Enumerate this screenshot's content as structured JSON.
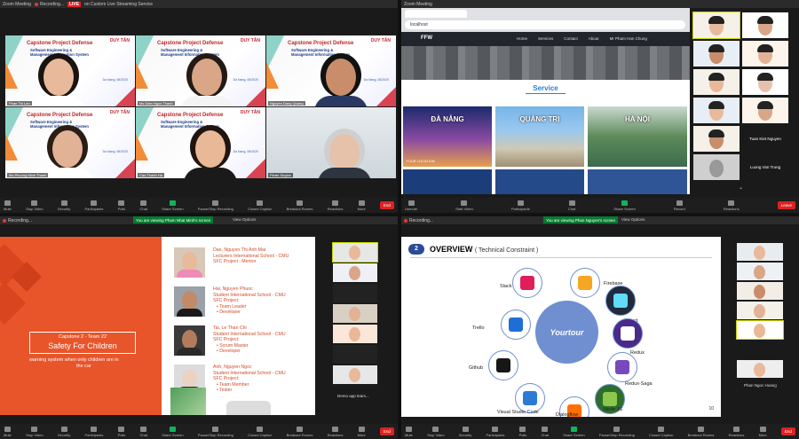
{
  "w1": {
    "title": "Zoom Meeting",
    "rec": "Recording...",
    "live": "LIVE",
    "stream": "on Custom Live Streaming Service",
    "tiles": [
      {
        "name": "Phan Thi Lan"
      },
      {
        "name": "Ms Dam Ngoc Thanh"
      },
      {
        "name": "Nguyen Dang Quang"
      },
      {
        "name": "Ms Phuong Minh Thanh"
      },
      {
        "name": "Cao Thanh Ha"
      },
      {
        "name": "Pieter Sluyter"
      }
    ],
    "slide_title": "Capstone Project Defense",
    "slide_sub1": "Software Engineering &",
    "slide_sub2": "Management Information System",
    "logo": "DUY TÂN",
    "date": "Da Nang, 06/2020",
    "toolbar": [
      "Mute",
      "Stop Video",
      "Security",
      "Participants",
      "Polls",
      "Chat",
      "Share Screen",
      "Pause/Stop Recording",
      "Closed Caption",
      "Breakout Rooms",
      "Reactions",
      "More"
    ],
    "end": "End"
  },
  "w2": {
    "url": "localhost",
    "brand": "FFW",
    "nav": [
      "Home",
      "Services",
      "Contact",
      "About",
      "Mr Pham Han Chung"
    ],
    "section": "Service",
    "cities": [
      "ĐÀ NẴNG",
      "QUẢNG TRỊ",
      "HÀ NỘI"
    ],
    "location": "YOUR LOCATION",
    "participants": [
      "Tuan Kiet Nguyen",
      "Luong Van Trung"
    ],
    "toolbar": [
      "Unmute",
      "Start Video",
      "Participants",
      "Chat",
      "Share Screen",
      "Record",
      "Reactions"
    ],
    "end": "Leave"
  },
  "w3": {
    "rec": "Recording...",
    "banner": "You are viewing Pham Nhat Minh's screen",
    "options": "View Options",
    "team": "Capstone 2 - Team 22",
    "project": "Safety For Children",
    "desc1": "warning system when only children are in",
    "desc2": "the car",
    "members": [
      {
        "l1": "Dao, Nguyen Thi Anh Mai",
        "l2": "Lecturers International School - CMU",
        "l3": "SFC Project : Mentor",
        "b": []
      },
      {
        "l1": "Hai, Nguyen Phuoc",
        "l2": "Student International School - CMU",
        "l3": "SFC Project:",
        "b": [
          "Team Leader",
          "Developer"
        ]
      },
      {
        "l1": "Tai, Le Than Chi",
        "l2": "Student International School - CMU",
        "l3": "SFC Project:",
        "b": [
          "Scrum Master",
          "Developer"
        ]
      },
      {
        "l1": "Anh, Nguyen Ngoc",
        "l2": "Student International School - CMU",
        "l3": "SFC Project:",
        "b": [
          "Team Member",
          "Tester"
        ]
      }
    ],
    "side": "Demo app team...",
    "toolbar": [
      "Mute",
      "Stop Video",
      "Security",
      "Participants",
      "Polls",
      "Chat",
      "Share Screen",
      "Pause/Stop Recording",
      "Closed Caption",
      "Breakout Rooms",
      "Reactions",
      "More"
    ],
    "end": "End"
  },
  "w4": {
    "rec": "Recording...",
    "banner": "You are viewing Phan Nguyen's screen",
    "options": "View Options",
    "num": "2",
    "heading": "OVERVIEW",
    "heading2": "( Technical Constraint )",
    "center": "Yourtour",
    "techs": [
      "Slack",
      "Firebase",
      "React",
      "Redux",
      "Redux-Saga",
      "Node JS",
      "Dialogflow",
      "Visual Studio Code",
      "Github",
      "Trello"
    ],
    "page": "10",
    "side": "Phan Ngoc Hoang",
    "toolbar": [
      "Mute",
      "Stop Video",
      "Security",
      "Participants",
      "Polls",
      "Chat",
      "Share Screen",
      "Pause/Stop Recording",
      "Closed Caption",
      "Breakout Rooms",
      "Reactions",
      "More"
    ],
    "end": "End"
  },
  "colors": {
    "accent": "#0a7a31",
    "end": "#dd2222",
    "slide_orange": "#e8552b",
    "zoom_blue": "#2d8cff"
  }
}
